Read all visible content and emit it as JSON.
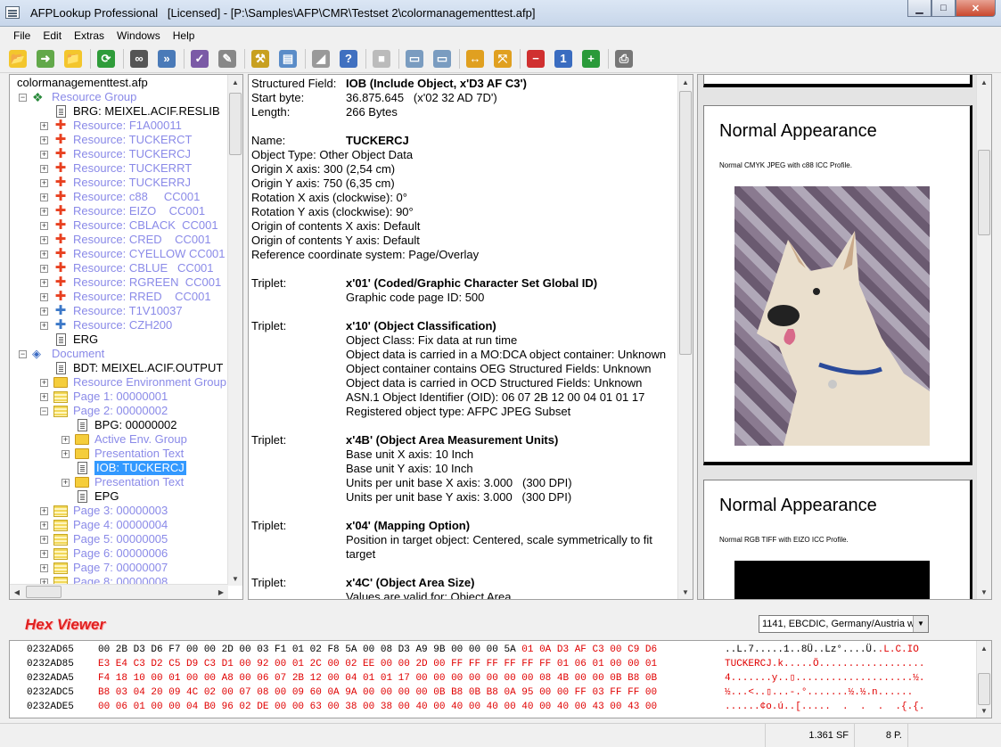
{
  "window": {
    "title": "AFPLookup Professional   [Licensed] - [P:\\Samples\\AFP\\CMR\\Testset 2\\colormanagementtest.afp]",
    "minimize": "▁",
    "maximize": "□",
    "close": "✕"
  },
  "menu": [
    "File",
    "Edit",
    "Extras",
    "Windows",
    "Help"
  ],
  "toolbar": [
    {
      "name": "open-icon",
      "glyph": "📂",
      "bg": "#f3c62c"
    },
    {
      "name": "export-icon",
      "glyph": "➜",
      "bg": "#62a84a"
    },
    {
      "name": "folder-icon",
      "glyph": "📁",
      "bg": "#f3c62c"
    },
    {
      "name": "refresh-icon",
      "glyph": "⟳",
      "bg": "#2f9c3a"
    },
    {
      "name": "find-icon",
      "glyph": "∞",
      "bg": "#555"
    },
    {
      "name": "find-next-icon",
      "glyph": "»",
      "bg": "#4a7ab8"
    },
    {
      "name": "checklist-icon",
      "glyph": "✓",
      "bg": "#7b5aa6"
    },
    {
      "name": "extract-icon",
      "glyph": "✎",
      "bg": "#888"
    },
    {
      "name": "tools-icon",
      "glyph": "⚒",
      "bg": "#c8a020"
    },
    {
      "name": "preview-icon",
      "glyph": "▤",
      "bg": "#5a8cc8"
    },
    {
      "name": "image-icon",
      "glyph": "◢",
      "bg": "#999"
    },
    {
      "name": "help-icon",
      "glyph": "?",
      "bg": "#4070c0"
    },
    {
      "name": "stop-icon",
      "glyph": "■",
      "bg": "#bbb"
    },
    {
      "name": "page-prev-icon",
      "glyph": "▭",
      "bg": "#7a9cc0"
    },
    {
      "name": "page-next-icon",
      "glyph": "▭",
      "bg": "#7a9cc0"
    },
    {
      "name": "fit-width-icon",
      "glyph": "↔",
      "bg": "#e0a020"
    },
    {
      "name": "fit-page-icon",
      "glyph": "⤧",
      "bg": "#e0a020"
    },
    {
      "name": "zoom-out-icon",
      "glyph": "−",
      "bg": "#d03030"
    },
    {
      "name": "zoom-actual-icon",
      "glyph": "1",
      "bg": "#3a6cc0"
    },
    {
      "name": "zoom-in-icon",
      "glyph": "+",
      "bg": "#2a9a3a"
    },
    {
      "name": "print-icon",
      "glyph": "⎙",
      "bg": "#777"
    }
  ],
  "tree": {
    "root": "colormanagementtest.afp",
    "rows": [
      {
        "indent": 0,
        "exp": "−",
        "icon": "grp",
        "label": "Resource Group",
        "link": true
      },
      {
        "indent": 1,
        "exp": "",
        "icon": "doc",
        "label": "BRG: MEIXEL.ACIF.RESLIB",
        "link": false
      },
      {
        "indent": 1,
        "exp": "+",
        "icon": "puz-r",
        "label": "Resource: F1A00011",
        "link": true
      },
      {
        "indent": 1,
        "exp": "+",
        "icon": "puz-r",
        "label": "Resource: TUCKERCT",
        "link": true
      },
      {
        "indent": 1,
        "exp": "+",
        "icon": "puz-r",
        "label": "Resource: TUCKERCJ",
        "link": true
      },
      {
        "indent": 1,
        "exp": "+",
        "icon": "puz-r",
        "label": "Resource: TUCKERRT",
        "link": true
      },
      {
        "indent": 1,
        "exp": "+",
        "icon": "puz-r",
        "label": "Resource: TUCKERRJ",
        "link": true
      },
      {
        "indent": 1,
        "exp": "+",
        "icon": "puz-r",
        "label": "Resource: c88     CC001",
        "link": true
      },
      {
        "indent": 1,
        "exp": "+",
        "icon": "puz-r",
        "label": "Resource: EIZO    CC001",
        "link": true
      },
      {
        "indent": 1,
        "exp": "+",
        "icon": "puz-r",
        "label": "Resource: CBLACK  CC001",
        "link": true
      },
      {
        "indent": 1,
        "exp": "+",
        "icon": "puz-r",
        "label": "Resource: CRED    CC001",
        "link": true
      },
      {
        "indent": 1,
        "exp": "+",
        "icon": "puz-r",
        "label": "Resource: CYELLOW CC001",
        "link": true
      },
      {
        "indent": 1,
        "exp": "+",
        "icon": "puz-r",
        "label": "Resource: CBLUE   CC001",
        "link": true
      },
      {
        "indent": 1,
        "exp": "+",
        "icon": "puz-r",
        "label": "Resource: RGREEN  CC001",
        "link": true
      },
      {
        "indent": 1,
        "exp": "+",
        "icon": "puz-r",
        "label": "Resource: RRED    CC001",
        "link": true
      },
      {
        "indent": 1,
        "exp": "+",
        "icon": "puz-b",
        "label": "Resource: T1V10037",
        "link": true
      },
      {
        "indent": 1,
        "exp": "+",
        "icon": "puz-b",
        "label": "Resource: CZH200",
        "link": true
      },
      {
        "indent": 1,
        "exp": "",
        "icon": "doc",
        "label": "ERG",
        "link": false
      },
      {
        "indent": 0,
        "exp": "−",
        "icon": "docicon",
        "label": "Document",
        "link": true
      },
      {
        "indent": 1,
        "exp": "",
        "icon": "doc",
        "label": "BDT: MEIXEL.ACIF.OUTPUT",
        "link": false
      },
      {
        "indent": 1,
        "exp": "+",
        "icon": "folder",
        "label": "Resource Environment Group",
        "link": true
      },
      {
        "indent": 1,
        "exp": "+",
        "icon": "page",
        "label": "Page 1: 00000001",
        "link": true
      },
      {
        "indent": 1,
        "exp": "−",
        "icon": "page",
        "label": "Page 2: 00000002",
        "link": true
      },
      {
        "indent": 2,
        "exp": "",
        "icon": "doc",
        "label": "BPG: 00000002",
        "link": false
      },
      {
        "indent": 2,
        "exp": "+",
        "icon": "folder",
        "label": "Active Env. Group",
        "link": true
      },
      {
        "indent": 2,
        "exp": "+",
        "icon": "folder",
        "label": "Presentation Text",
        "link": true
      },
      {
        "indent": 2,
        "exp": "",
        "icon": "doc",
        "label": "IOB: TUCKERCJ",
        "link": false,
        "selected": true
      },
      {
        "indent": 2,
        "exp": "+",
        "icon": "folder",
        "label": "Presentation Text",
        "link": true
      },
      {
        "indent": 2,
        "exp": "",
        "icon": "doc",
        "label": "EPG",
        "link": false
      },
      {
        "indent": 1,
        "exp": "+",
        "icon": "page",
        "label": "Page 3: 00000003",
        "link": true
      },
      {
        "indent": 1,
        "exp": "+",
        "icon": "page",
        "label": "Page 4: 00000004",
        "link": true
      },
      {
        "indent": 1,
        "exp": "+",
        "icon": "page",
        "label": "Page 5: 00000005",
        "link": true
      },
      {
        "indent": 1,
        "exp": "+",
        "icon": "page",
        "label": "Page 6: 00000006",
        "link": true
      },
      {
        "indent": 1,
        "exp": "+",
        "icon": "page",
        "label": "Page 7: 00000007",
        "link": true
      },
      {
        "indent": 1,
        "exp": "+",
        "icon": "page",
        "label": "Page 8: 00000008",
        "link": true
      }
    ]
  },
  "info": {
    "lines": [
      {
        "label": "Structured Field:",
        "value": "IOB (Include Object, x'D3 AF C3')",
        "bold": true
      },
      {
        "label": "Start byte:",
        "value": "36.875.645   (x'02 32 AD 7D')"
      },
      {
        "label": "Length:",
        "value": "266 Bytes"
      },
      {
        "label": "",
        "value": ""
      },
      {
        "label": "Name:",
        "value": "TUCKERCJ",
        "bold": true
      },
      {
        "label": "Object Type: Other Object Data",
        "value": ""
      },
      {
        "label": "Origin X axis: 300   (2,54 cm)",
        "value": ""
      },
      {
        "label": "Origin Y axis: 750   (6,35 cm)",
        "value": ""
      },
      {
        "label": "Rotation X axis (clockwise): 0°",
        "value": ""
      },
      {
        "label": "Rotation Y axis (clockwise): 90°",
        "value": ""
      },
      {
        "label": "Origin of contents X axis: Default",
        "value": ""
      },
      {
        "label": "Origin of contents Y axis: Default",
        "value": ""
      },
      {
        "label": "Reference coordinate system: Page/Overlay",
        "value": ""
      },
      {
        "label": "",
        "value": ""
      },
      {
        "label": "Triplet:",
        "value": "x'01' (Coded/Graphic Character Set Global ID)",
        "bold": true
      },
      {
        "label": "",
        "value": "Graphic code page ID: 500"
      },
      {
        "label": "",
        "value": ""
      },
      {
        "label": "Triplet:",
        "value": "x'10' (Object Classification)",
        "bold": true
      },
      {
        "label": "",
        "value": "Object Class: Fix data at run time"
      },
      {
        "label": "",
        "value": "Object data is carried in a MO:DCA object container: Unknown"
      },
      {
        "label": "",
        "value": "Object container contains OEG Structured Fields: Unknown"
      },
      {
        "label": "",
        "value": "Object data is carried in OCD Structured Fields: Unknown"
      },
      {
        "label": "",
        "value": "ASN.1 Object Identifier (OID): 06 07 2B 12 00 04 01 01 17"
      },
      {
        "label": "",
        "value": "Registered object type: AFPC JPEG Subset"
      },
      {
        "label": "",
        "value": ""
      },
      {
        "label": "Triplet:",
        "value": "x'4B' (Object Area Measurement Units)",
        "bold": true
      },
      {
        "label": "",
        "value": "Base unit X axis: 10 Inch"
      },
      {
        "label": "",
        "value": "Base unit Y axis: 10 Inch"
      },
      {
        "label": "",
        "value": "Units per unit base X axis: 3.000   (300 DPI)"
      },
      {
        "label": "",
        "value": "Units per unit base Y axis: 3.000   (300 DPI)"
      },
      {
        "label": "",
        "value": ""
      },
      {
        "label": "Triplet:",
        "value": "x'04' (Mapping Option)",
        "bold": true
      },
      {
        "label": "",
        "value": "Position in target object: Centered, scale symmetrically to fit"
      },
      {
        "label": "",
        "value": "target"
      },
      {
        "label": "",
        "value": ""
      },
      {
        "label": "Triplet:",
        "value": "x'4C' (Object Area Size)",
        "bold": true
      },
      {
        "label": "",
        "value": "Values are valid for: Object Area"
      }
    ]
  },
  "preview": {
    "page1": {
      "heading": "Normal Appearance",
      "caption": "Normal CMYK JPEG with c88 ICC Profile."
    },
    "page2": {
      "heading": "Normal Appearance",
      "caption": "Normal RGB TIFF with EIZO ICC Profile."
    }
  },
  "hex": {
    "title": "Hex Viewer",
    "encoding": "1141, EBCDIC, Germany/Austria with Euro",
    "rows": [
      {
        "offset": "0232AD65",
        "black": "00 2B D3 D6 F7 00 00 2D 00 03 F1 01 02 F8 5A 00 08 D3 A9 9B 00 00 00 5A ",
        "red": "01 0A D3 AF C3 00 C9 D6",
        "ascii_black": "..L.7.....1..8Ü..Lz°....Ü.",
        "ascii_red": ".L.C.IO"
      },
      {
        "offset": "0232AD85",
        "black": "",
        "red": "E3 E4 C3 D2 C5 D9 C3 D1 00 92 00 01 2C 00 02 EE 00 00 2D 00 FF FF FF FF FF FF 01 06 01 00 00 01",
        "ascii_black": "",
        "ascii_red": "TUCKERCJ.k.....Ö.................."
      },
      {
        "offset": "0232ADA5",
        "black": "",
        "red": "F4 18 10 00 01 00 00 A8 00 06 07 2B 12 00 04 01 01 17 00 00 00 00 00 00 00 08 4B 00 00 0B B8 0B",
        "ascii_black": "",
        "ascii_red": "4.......y..▯....................½."
      },
      {
        "offset": "0232ADC5",
        "black": "",
        "red": "B8 03 04 20 09 4C 02 00 07 08 00 09 60 0A 9A 00 00 00 00 0B B8 0B B8 0A 95 00 00 FF 03 FF FF 00",
        "ascii_black": "",
        "ascii_red": "½...<..▯...-.°.......½.½.n......"
      },
      {
        "offset": "0232ADE5",
        "black": "",
        "red": "00 06 01 00 00 04 B0 96 02 DE 00 00 63 00 38 00 38 00 40 00 40 00 40 00 40 00 40 00 43 00 43 00",
        "ascii_black": "",
        "ascii_red": "......¢o.ú..[.....  .  .  .  .{.{."
      }
    ]
  },
  "status": {
    "sf": "1.361 SF",
    "pages": "8 P."
  }
}
